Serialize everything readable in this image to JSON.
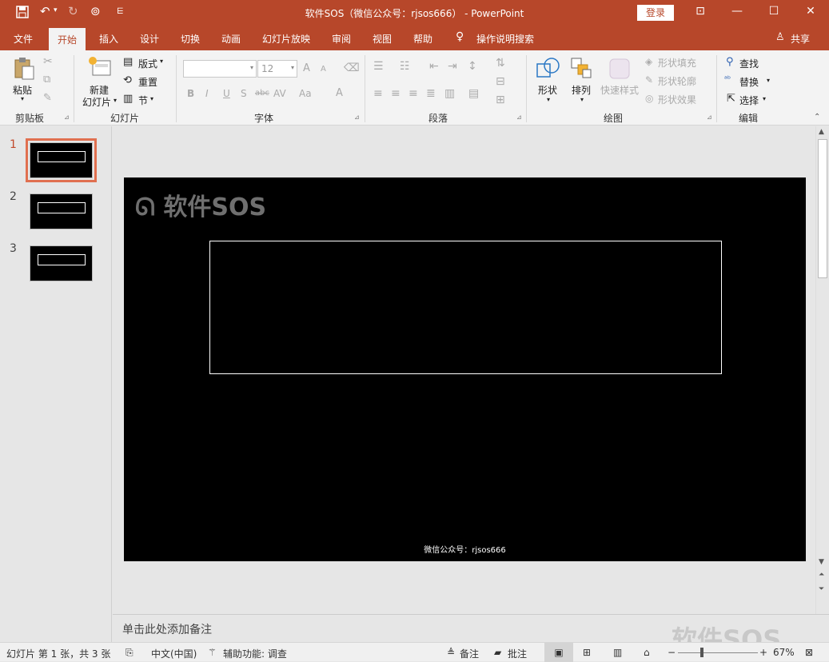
{
  "titlebar": {
    "title": "软件SOS（微信公众号：rjsos666） - PowerPoint",
    "login": "登录",
    "save_icon": "save-icon",
    "undo_icon": "undo-icon",
    "redo_icon": "redo-icon",
    "present_icon": "present-icon",
    "customize_icon": "customize-icon"
  },
  "tabs": [
    "文件",
    "开始",
    "插入",
    "设计",
    "切换",
    "动画",
    "幻灯片放映",
    "审阅",
    "视图",
    "帮助",
    "操作说明搜索"
  ],
  "share": "共享",
  "ribbon": {
    "clipboard": {
      "label": "剪贴板",
      "paste": "粘贴"
    },
    "slides": {
      "label": "幻灯片",
      "new_line1": "新建",
      "new_line2": "幻灯片",
      "layout": "版式",
      "reset": "重置",
      "section": "节"
    },
    "font": {
      "label": "字体",
      "font_size": "12",
      "bold": "B",
      "italic": "I",
      "underline": "U",
      "shadow": "S",
      "strike": "abc",
      "spacing": "AV",
      "case": "Aa",
      "color": "A",
      "grow": "A",
      "shrink": "A"
    },
    "paragraph": {
      "label": "段落"
    },
    "drawing": {
      "label": "绘图",
      "shapes": "形状",
      "arrange": "排列",
      "quick_styles": "快速样式",
      "shape_fill": "形状填充",
      "shape_outline": "形状轮廓",
      "shape_effects": "形状效果"
    },
    "editing": {
      "label": "编辑",
      "find": "查找",
      "replace": "替换",
      "select": "选择"
    }
  },
  "slides_panel": [
    {
      "num": "1"
    },
    {
      "num": "2"
    },
    {
      "num": "3"
    }
  ],
  "slide": {
    "logo": "软件SOS",
    "footer": "微信公众号：rjsos666"
  },
  "notes_placeholder": "单击此处添加备注",
  "status": {
    "slide_info": "幻灯片 第 1 张，共 3 张",
    "language": "中文(中国)",
    "accessibility": "辅助功能: 调查",
    "notes": "备注",
    "comments": "批注",
    "zoom": "67%"
  },
  "watermark": "软件SOS"
}
